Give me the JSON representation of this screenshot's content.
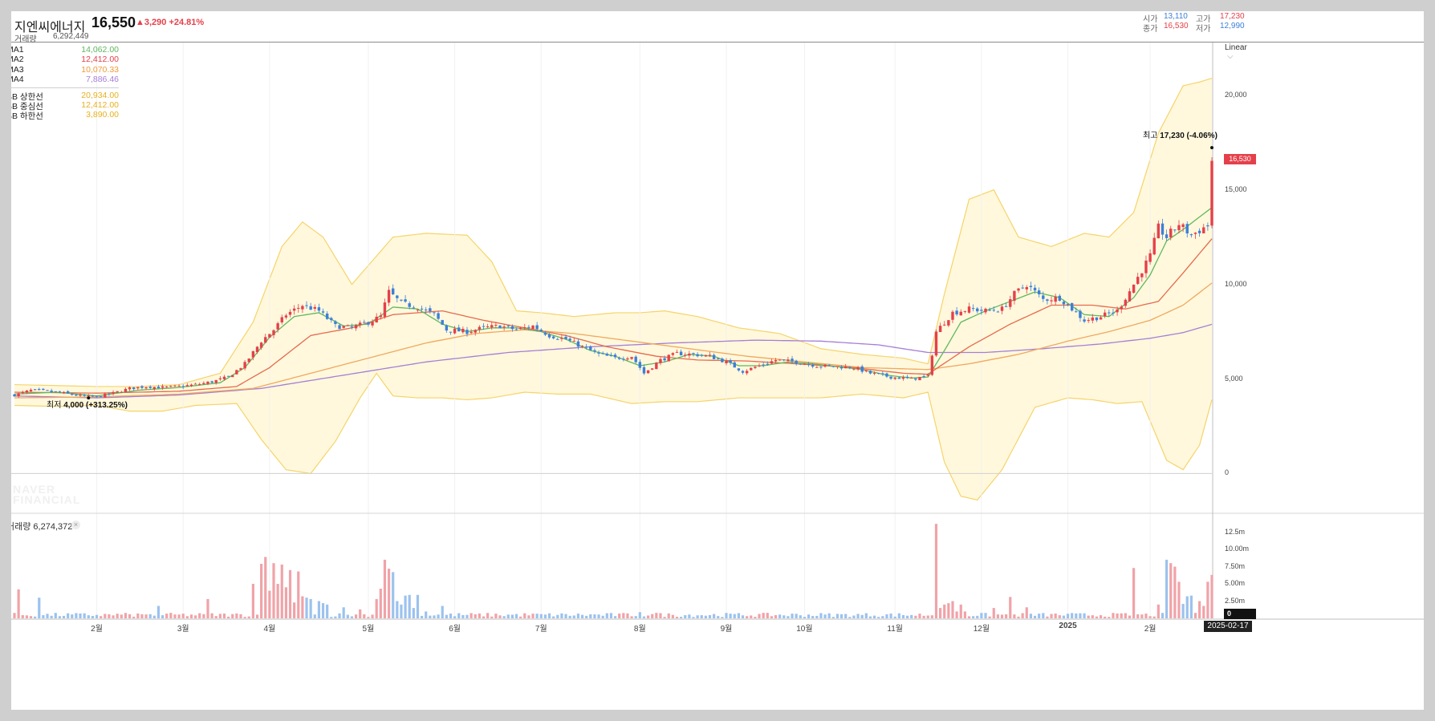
{
  "header": {
    "name": "지엔씨에너지",
    "price": "16,550",
    "change": "▲3,290 +24.81%",
    "volume_label": "거래량",
    "volume": "6,292,449",
    "ohlc": [
      {
        "key": "시가",
        "value": "13,110",
        "color": "blue"
      },
      {
        "key": "고가",
        "value": "17,230",
        "color": "red"
      },
      {
        "key": "종가",
        "value": "16,530",
        "color": "red"
      },
      {
        "key": "저가",
        "value": "12,990",
        "color": "blue"
      }
    ]
  },
  "legend": [
    {
      "name": "MA1",
      "value": "14,062.00",
      "color": "#5fb85f"
    },
    {
      "name": "MA2",
      "value": "12,412.00",
      "color": "#e5404a"
    },
    {
      "name": "MA3",
      "value": "10,070.33",
      "color": "#ef9a3c"
    },
    {
      "name": "MA4",
      "value": "7,886.46",
      "color": "#a57fd6"
    }
  ],
  "bb_legend": [
    {
      "name": "BB 상한선",
      "value": "20,934.00",
      "color": "#e8b020"
    },
    {
      "name": "BB 중심선",
      "value": "12,412.00",
      "color": "#e8b020"
    },
    {
      "name": "BB 하한선",
      "value": "3,890.00",
      "color": "#e8b020"
    }
  ],
  "scale_button": "Linear",
  "annotations": {
    "high_label": "최고",
    "high_value": "17,230 (-4.06%)",
    "low_label": "최저",
    "low_value": "4,000 (+313.25%)"
  },
  "current_price_tag": "16,530",
  "volume_panel": {
    "label": "거래량 6,274,372",
    "close_glyph": "×",
    "current_tag": "0"
  },
  "watermark": [
    "NAVER",
    "FINANCIAL"
  ],
  "date_tag": "2025-02-17",
  "colors": {
    "up": "#e5404a",
    "down": "#3d7fd9",
    "bb_fill": "#fff8dc",
    "bb_line": "#f5d46a",
    "ma1": "#5fb85f",
    "ma2": "#e56a50",
    "ma3": "#f0a860",
    "ma4": "#a57fd6"
  },
  "chart_data": {
    "type": "candlestick",
    "y_ticks": [
      "20,000",
      "15,000",
      "10,000",
      "5,000",
      "0"
    ],
    "y_tick_values": [
      20000,
      15000,
      10000,
      5000,
      0
    ],
    "ylim": [
      -1000,
      23000
    ],
    "volume_ticks": [
      "12.5m",
      "10.00m",
      "7.50m",
      "5.00m",
      "2.50m"
    ],
    "volume_tick_values": [
      12.5,
      10,
      7.5,
      5,
      2.5
    ],
    "volume_ylim": [
      0,
      15
    ],
    "x_ticks": [
      "2월",
      "3월",
      "4월",
      "5월",
      "6월",
      "7월",
      "8월",
      "9월",
      "10월",
      "11월",
      "12월",
      "2025",
      "2월"
    ],
    "x_tick_index": [
      20,
      41,
      62,
      86,
      107,
      128,
      152,
      173,
      192,
      214,
      235,
      256,
      276
    ],
    "price_anchors": [
      [
        0,
        4150
      ],
      [
        4,
        4400
      ],
      [
        8,
        4350
      ],
      [
        12,
        4250
      ],
      [
        16,
        4100
      ],
      [
        20,
        4050
      ],
      [
        24,
        4250
      ],
      [
        28,
        4500
      ],
      [
        32,
        4600
      ],
      [
        36,
        4550
      ],
      [
        40,
        4600
      ],
      [
        44,
        4700
      ],
      [
        48,
        4850
      ],
      [
        52,
        5100
      ],
      [
        56,
        5800
      ],
      [
        60,
        7000
      ],
      [
        63,
        7600
      ],
      [
        66,
        8400
      ],
      [
        70,
        8900
      ],
      [
        74,
        8600
      ],
      [
        78,
        7800
      ],
      [
        82,
        7700
      ],
      [
        86,
        8000
      ],
      [
        89,
        8300
      ],
      [
        91,
        9600
      ],
      [
        94,
        9000
      ],
      [
        98,
        8800
      ],
      [
        102,
        8400
      ],
      [
        105,
        7600
      ],
      [
        110,
        7500
      ],
      [
        114,
        7700
      ],
      [
        118,
        7800
      ],
      [
        122,
        7600
      ],
      [
        126,
        7800
      ],
      [
        130,
        7300
      ],
      [
        134,
        7100
      ],
      [
        138,
        6700
      ],
      [
        142,
        6300
      ],
      [
        146,
        6100
      ],
      [
        150,
        6200
      ],
      [
        153,
        5300
      ],
      [
        157,
        6000
      ],
      [
        161,
        6350
      ],
      [
        165,
        6300
      ],
      [
        169,
        6200
      ],
      [
        173,
        5900
      ],
      [
        177,
        5400
      ],
      [
        181,
        5700
      ],
      [
        185,
        6000
      ],
      [
        190,
        5900
      ],
      [
        195,
        5700
      ],
      [
        200,
        5650
      ],
      [
        204,
        5600
      ],
      [
        208,
        5300
      ],
      [
        213,
        5100
      ],
      [
        218,
        5000
      ],
      [
        222,
        5150
      ],
      [
        224,
        7500
      ],
      [
        228,
        8500
      ],
      [
        232,
        8700
      ],
      [
        236,
        8600
      ],
      [
        240,
        8700
      ],
      [
        243,
        9500
      ],
      [
        246,
        10000
      ],
      [
        250,
        9200
      ],
      [
        254,
        9300
      ],
      [
        257,
        8700
      ],
      [
        260,
        8100
      ],
      [
        264,
        8300
      ],
      [
        268,
        8600
      ],
      [
        272,
        10000
      ],
      [
        276,
        11500
      ],
      [
        278,
        13000
      ],
      [
        280,
        12500
      ],
      [
        283,
        13200
      ],
      [
        286,
        12600
      ],
      [
        289,
        13000
      ],
      [
        291,
        13200
      ]
    ],
    "bb_upper_anchors": [
      [
        0,
        4700
      ],
      [
        10,
        4650
      ],
      [
        20,
        4600
      ],
      [
        30,
        4600
      ],
      [
        40,
        4700
      ],
      [
        50,
        5300
      ],
      [
        58,
        8000
      ],
      [
        65,
        12000
      ],
      [
        70,
        13300
      ],
      [
        75,
        12500
      ],
      [
        82,
        10000
      ],
      [
        88,
        11500
      ],
      [
        92,
        12500
      ],
      [
        100,
        12700
      ],
      [
        110,
        12600
      ],
      [
        116,
        11200
      ],
      [
        122,
        8600
      ],
      [
        128,
        8500
      ],
      [
        136,
        8300
      ],
      [
        146,
        8500
      ],
      [
        152,
        8500
      ],
      [
        158,
        8600
      ],
      [
        166,
        8300
      ],
      [
        176,
        7700
      ],
      [
        186,
        7400
      ],
      [
        196,
        6600
      ],
      [
        206,
        6300
      ],
      [
        216,
        6100
      ],
      [
        222,
        5800
      ],
      [
        226,
        9500
      ],
      [
        232,
        14500
      ],
      [
        238,
        15000
      ],
      [
        244,
        12500
      ],
      [
        252,
        12000
      ],
      [
        260,
        12700
      ],
      [
        266,
        12500
      ],
      [
        272,
        13800
      ],
      [
        278,
        18000
      ],
      [
        284,
        20500
      ],
      [
        288,
        20700
      ],
      [
        291,
        20900
      ]
    ],
    "bb_lower_anchors": [
      [
        0,
        3600
      ],
      [
        10,
        3550
      ],
      [
        20,
        3600
      ],
      [
        28,
        3300
      ],
      [
        36,
        3300
      ],
      [
        44,
        3600
      ],
      [
        54,
        3700
      ],
      [
        60,
        1800
      ],
      [
        66,
        200
      ],
      [
        72,
        0
      ],
      [
        78,
        1700
      ],
      [
        84,
        4000
      ],
      [
        88,
        5300
      ],
      [
        92,
        4100
      ],
      [
        98,
        4000
      ],
      [
        104,
        4000
      ],
      [
        110,
        3900
      ],
      [
        116,
        4000
      ],
      [
        124,
        4300
      ],
      [
        132,
        4200
      ],
      [
        140,
        4200
      ],
      [
        150,
        3700
      ],
      [
        158,
        3800
      ],
      [
        166,
        3800
      ],
      [
        176,
        4000
      ],
      [
        186,
        4000
      ],
      [
        196,
        4000
      ],
      [
        206,
        4200
      ],
      [
        216,
        4000
      ],
      [
        222,
        4300
      ],
      [
        226,
        600
      ],
      [
        230,
        -1200
      ],
      [
        234,
        -1400
      ],
      [
        240,
        200
      ],
      [
        248,
        3500
      ],
      [
        256,
        4000
      ],
      [
        262,
        3900
      ],
      [
        268,
        3700
      ],
      [
        274,
        3800
      ],
      [
        280,
        700
      ],
      [
        284,
        200
      ],
      [
        288,
        1500
      ],
      [
        291,
        3900
      ]
    ],
    "ma1_anchors": [
      [
        0,
        4200
      ],
      [
        10,
        4300
      ],
      [
        20,
        4100
      ],
      [
        30,
        4400
      ],
      [
        40,
        4550
      ],
      [
        50,
        4800
      ],
      [
        56,
        5600
      ],
      [
        62,
        7200
      ],
      [
        68,
        8300
      ],
      [
        74,
        8500
      ],
      [
        80,
        7800
      ],
      [
        86,
        7900
      ],
      [
        92,
        8800
      ],
      [
        98,
        8700
      ],
      [
        104,
        7900
      ],
      [
        110,
        7500
      ],
      [
        116,
        7700
      ],
      [
        122,
        7700
      ],
      [
        128,
        7500
      ],
      [
        134,
        7100
      ],
      [
        140,
        6500
      ],
      [
        146,
        6200
      ],
      [
        152,
        5700
      ],
      [
        158,
        5900
      ],
      [
        164,
        6300
      ],
      [
        170,
        6200
      ],
      [
        176,
        5700
      ],
      [
        182,
        5700
      ],
      [
        188,
        5900
      ],
      [
        194,
        5800
      ],
      [
        200,
        5650
      ],
      [
        206,
        5500
      ],
      [
        212,
        5200
      ],
      [
        218,
        5050
      ],
      [
        222,
        5100
      ],
      [
        226,
        6500
      ],
      [
        230,
        8000
      ],
      [
        236,
        8600
      ],
      [
        242,
        9100
      ],
      [
        248,
        9600
      ],
      [
        254,
        9300
      ],
      [
        260,
        8400
      ],
      [
        266,
        8300
      ],
      [
        272,
        9300
      ],
      [
        276,
        10500
      ],
      [
        280,
        12300
      ],
      [
        284,
        12900
      ],
      [
        291,
        14062
      ]
    ],
    "ma2_anchors": [
      [
        0,
        4300
      ],
      [
        20,
        4250
      ],
      [
        40,
        4350
      ],
      [
        54,
        4600
      ],
      [
        62,
        5600
      ],
      [
        72,
        7300
      ],
      [
        82,
        7700
      ],
      [
        92,
        8400
      ],
      [
        104,
        8600
      ],
      [
        114,
        8100
      ],
      [
        124,
        7700
      ],
      [
        134,
        7300
      ],
      [
        144,
        6700
      ],
      [
        156,
        6200
      ],
      [
        166,
        6000
      ],
      [
        178,
        5950
      ],
      [
        190,
        5800
      ],
      [
        204,
        5600
      ],
      [
        216,
        5300
      ],
      [
        222,
        5250
      ],
      [
        232,
        6700
      ],
      [
        242,
        7900
      ],
      [
        252,
        8900
      ],
      [
        262,
        8900
      ],
      [
        270,
        8700
      ],
      [
        278,
        9100
      ],
      [
        284,
        10600
      ],
      [
        291,
        12412
      ]
    ],
    "ma3_anchors": [
      [
        0,
        4000
      ],
      [
        20,
        4050
      ],
      [
        40,
        4200
      ],
      [
        58,
        4500
      ],
      [
        72,
        5300
      ],
      [
        86,
        6100
      ],
      [
        100,
        6900
      ],
      [
        112,
        7400
      ],
      [
        124,
        7600
      ],
      [
        136,
        7400
      ],
      [
        150,
        7000
      ],
      [
        164,
        6600
      ],
      [
        178,
        6200
      ],
      [
        192,
        5900
      ],
      [
        206,
        5600
      ],
      [
        222,
        5500
      ],
      [
        232,
        5800
      ],
      [
        244,
        6300
      ],
      [
        256,
        7000
      ],
      [
        266,
        7500
      ],
      [
        276,
        8100
      ],
      [
        284,
        8900
      ],
      [
        291,
        10070
      ]
    ],
    "ma4_anchors": [
      [
        0,
        4100
      ],
      [
        20,
        4000
      ],
      [
        40,
        4150
      ],
      [
        60,
        4500
      ],
      [
        80,
        5200
      ],
      [
        100,
        5900
      ],
      [
        120,
        6400
      ],
      [
        140,
        6700
      ],
      [
        160,
        6900
      ],
      [
        180,
        7050
      ],
      [
        196,
        7000
      ],
      [
        210,
        6800
      ],
      [
        222,
        6400
      ],
      [
        236,
        6400
      ],
      [
        250,
        6600
      ],
      [
        264,
        6850
      ],
      [
        276,
        7150
      ],
      [
        284,
        7450
      ],
      [
        291,
        7886
      ]
    ],
    "volume_spikes": [
      [
        1,
        4.2
      ],
      [
        6,
        3.0
      ],
      [
        28,
        0.6
      ],
      [
        33,
        0.6
      ],
      [
        35,
        1.8
      ],
      [
        47,
        2.8
      ],
      [
        58,
        5.0
      ],
      [
        60,
        7.9
      ],
      [
        61,
        8.9
      ],
      [
        62,
        4.0
      ],
      [
        63,
        8.0
      ],
      [
        64,
        5.0
      ],
      [
        65,
        7.8
      ],
      [
        66,
        4.5
      ],
      [
        67,
        7.0
      ],
      [
        68,
        2.3
      ],
      [
        69,
        6.8
      ],
      [
        70,
        3.2
      ],
      [
        71,
        3.0
      ],
      [
        72,
        2.8
      ],
      [
        74,
        2.5
      ],
      [
        75,
        2.2
      ],
      [
        76,
        2.0
      ],
      [
        80,
        1.6
      ],
      [
        84,
        1.3
      ],
      [
        88,
        2.8
      ],
      [
        89,
        4.3
      ],
      [
        90,
        8.5
      ],
      [
        91,
        7.2
      ],
      [
        92,
        6.7
      ],
      [
        93,
        2.5
      ],
      [
        94,
        2.0
      ],
      [
        95,
        3.3
      ],
      [
        96,
        3.4
      ],
      [
        97,
        1.5
      ],
      [
        98,
        3.4
      ],
      [
        100,
        1.0
      ],
      [
        104,
        1.8
      ],
      [
        152,
        0.9
      ],
      [
        156,
        0.8
      ],
      [
        224,
        13.7
      ],
      [
        225,
        1.5
      ],
      [
        226,
        2.0
      ],
      [
        227,
        2.2
      ],
      [
        228,
        2.5
      ],
      [
        229,
        1.0
      ],
      [
        230,
        2.0
      ],
      [
        231,
        1.0
      ],
      [
        238,
        1.5
      ],
      [
        242,
        3.1
      ],
      [
        246,
        1.6
      ],
      [
        272,
        7.3
      ],
      [
        278,
        2.0
      ],
      [
        280,
        8.5
      ],
      [
        281,
        8.0
      ],
      [
        282,
        7.5
      ],
      [
        283,
        5.3
      ],
      [
        284,
        2.1
      ],
      [
        285,
        3.2
      ],
      [
        286,
        3.3
      ],
      [
        288,
        2.5
      ],
      [
        289,
        1.8
      ],
      [
        290,
        5.3
      ],
      [
        291,
        6.3
      ]
    ]
  }
}
